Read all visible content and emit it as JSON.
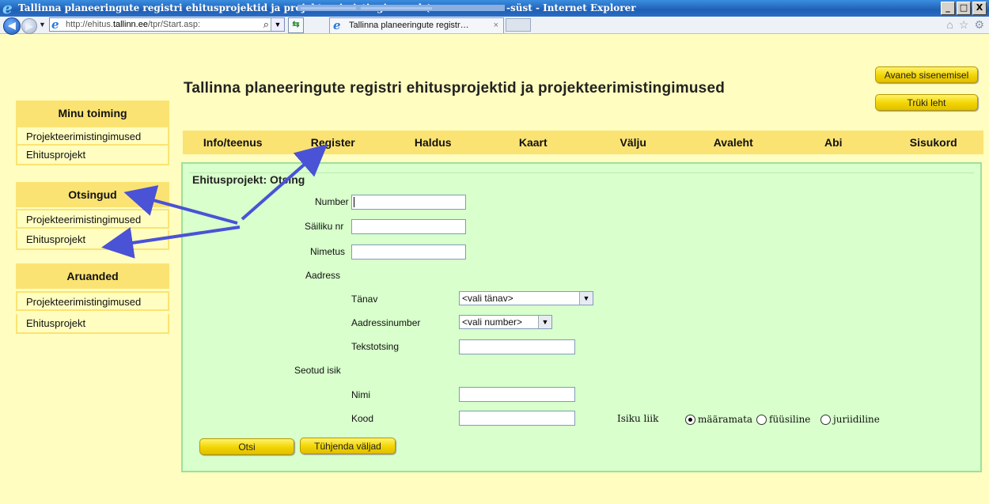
{
  "window": {
    "title_left": "Tallinna planeeringute registri ehitusprojektid ja projekteerimistingimused (",
    "title_right": "-süst - Internet Explorer",
    "buttons": {
      "minimize": "_",
      "maximize": "□",
      "close": "X"
    }
  },
  "browser": {
    "url_host_prefix": "http://ehitus.",
    "url_host_bold": "tallinn.ee",
    "url_path": "/tpr/Start.asp:",
    "tab_title": "Tallinna planeeringute registr…",
    "tab_close": "×",
    "search_glyph": "⌕",
    "icons": [
      "home-icon",
      "star-icon",
      "gear-icon"
    ]
  },
  "page": {
    "title": "Tallinna planeeringute registri ehitusprojektid ja projekteerimistingimused",
    "btn_avaneb": "Avaneb sisenemisel",
    "btn_truki": "Trüki leht"
  },
  "sidebar": {
    "sections": [
      {
        "header": "Minu toiming",
        "items": [
          "Projekteerimistingimused",
          "Ehitusprojekt"
        ]
      },
      {
        "header": "Otsingud",
        "items": [
          "Projekteerimistingimused",
          "Ehitusprojekt"
        ]
      },
      {
        "header": "Aruanded",
        "items": [
          "Projekteerimistingimused",
          "Ehitusprojekt"
        ]
      }
    ]
  },
  "nav": [
    "Info/teenus",
    "Register",
    "Haldus",
    "Kaart",
    "Välju",
    "Avaleht",
    "Abi",
    "Sisukord"
  ],
  "form": {
    "title": "Ehitusprojekt: Otsing",
    "number_label": "Number",
    "sailiku_label": "Säiliku nr",
    "nimetus_label": "Nimetus",
    "aadress_label": "Aadress",
    "tanav_label": "Tänav",
    "tanav_value": "<vali tänav>",
    "aadressinumber_label": "Aadressinumber",
    "aadressinumber_value": "<vali number>",
    "tekstotsing_label": "Tekstotsing",
    "seotud_label": "Seotud isik",
    "nimi_label": "Nimi",
    "kood_label": "Kood",
    "isiku_liik_label": "Isiku liik",
    "radio_options": [
      "määramata",
      "füüsiline",
      "juriidiline"
    ],
    "radio_selected": "määramata",
    "btn_otsi": "Otsi",
    "btn_tuhjenda": "Tühjenda väljad"
  },
  "colors": {
    "page_bg": "#fffdbf",
    "accent_yellow": "#fbe373",
    "panel_bg": "#d8ffcc",
    "arrow": "#4a52d6"
  }
}
